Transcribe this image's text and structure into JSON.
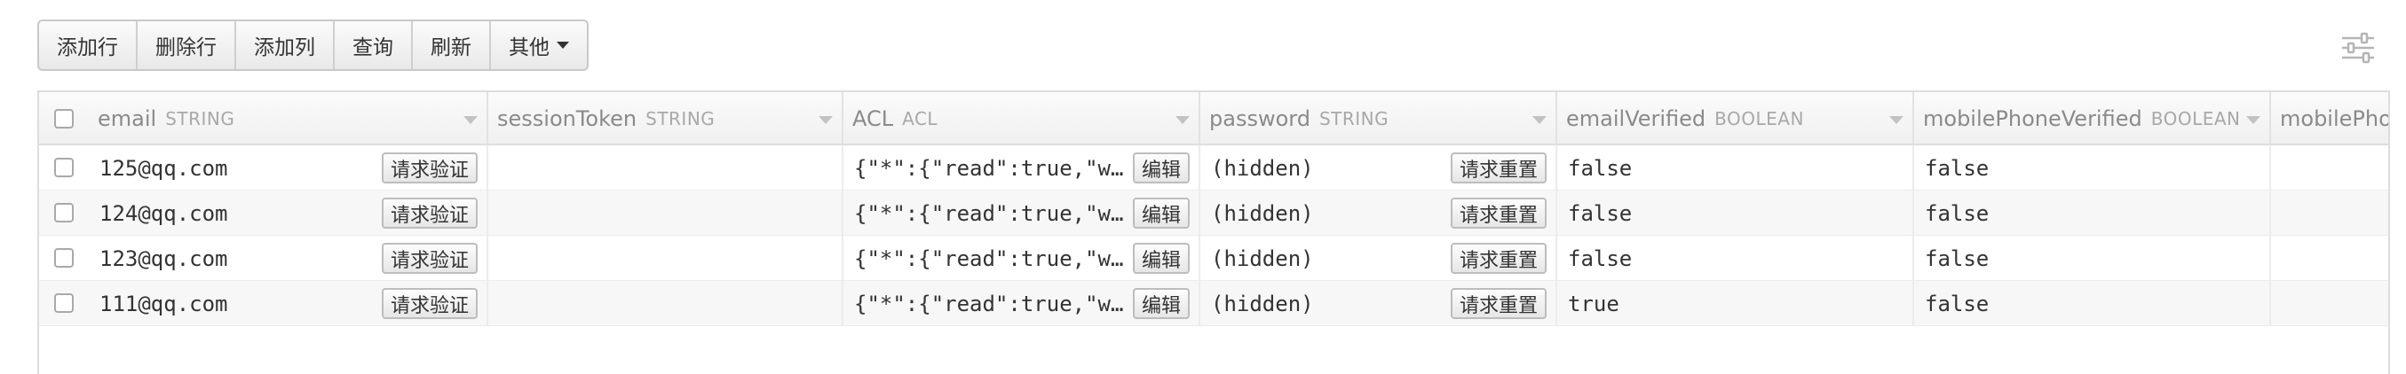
{
  "toolbar": {
    "add_row": "添加行",
    "delete_row": "删除行",
    "add_column": "添加列",
    "query": "查询",
    "refresh": "刷新",
    "more": "其他"
  },
  "icons": {
    "settings": "sliders-icon",
    "dropdown": "chevron-down-icon"
  },
  "table": {
    "columns": [
      {
        "name": "email",
        "type": "STRING"
      },
      {
        "name": "sessionToken",
        "type": "STRING"
      },
      {
        "name": "ACL",
        "type": "ACL"
      },
      {
        "name": "password",
        "type": "STRING"
      },
      {
        "name": "emailVerified",
        "type": "BOOLEAN"
      },
      {
        "name": "mobilePhoneVerified",
        "type": "BOOLEAN"
      },
      {
        "name": "mobilePhoneN",
        "type": ""
      }
    ],
    "buttons": {
      "verify": "请求验证",
      "edit": "编辑",
      "reset": "请求重置"
    },
    "rows": [
      {
        "email": "125@qq.com",
        "sessionToken": "",
        "acl": "{\"*\":{\"read\":true,\"w…",
        "password": "(hidden)",
        "emailVerified": "false",
        "mobilePhoneVerified": "false"
      },
      {
        "email": "124@qq.com",
        "sessionToken": "",
        "acl": "{\"*\":{\"read\":true,\"w…",
        "password": "(hidden)",
        "emailVerified": "false",
        "mobilePhoneVerified": "false"
      },
      {
        "email": "123@qq.com",
        "sessionToken": "",
        "acl": "{\"*\":{\"read\":true,\"w…",
        "password": "(hidden)",
        "emailVerified": "false",
        "mobilePhoneVerified": "false"
      },
      {
        "email": "111@qq.com",
        "sessionToken": "",
        "acl": "{\"*\":{\"read\":true,\"w…",
        "password": "(hidden)",
        "emailVerified": "true",
        "mobilePhoneVerified": "false"
      }
    ]
  }
}
